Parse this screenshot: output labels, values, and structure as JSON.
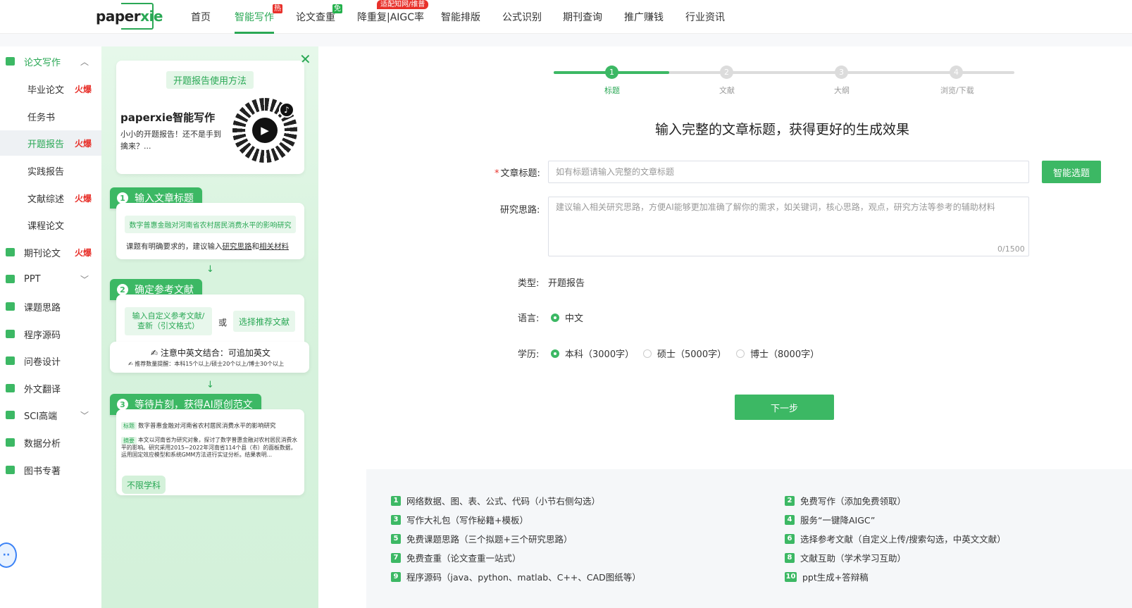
{
  "nav": {
    "logo": "paperxie",
    "items": [
      {
        "label": "首页"
      },
      {
        "label": "智能写作",
        "badge": "热"
      },
      {
        "label": "论文查重",
        "badge": "免"
      },
      {
        "label": "降重复|AIGC率",
        "badge": "适配知网/维普"
      },
      {
        "label": "智能排版"
      },
      {
        "label": "公式识别"
      },
      {
        "label": "期刊查询"
      },
      {
        "label": "推广赚钱"
      },
      {
        "label": "行业资讯"
      }
    ],
    "active": "智能写作"
  },
  "sidebar": {
    "hot_label": "火爆",
    "items": [
      {
        "label": "论文写作",
        "icon": "pen-icon",
        "expanded": true
      },
      {
        "label": "毕业论文",
        "hot": true
      },
      {
        "label": "任务书"
      },
      {
        "label": "开题报告",
        "hot": true,
        "active": true
      },
      {
        "label": "实践报告"
      },
      {
        "label": "文献综述",
        "hot": true
      },
      {
        "label": "课程论文"
      },
      {
        "label": "期刊论文",
        "icon": "journal-icon",
        "hot": true
      },
      {
        "label": "PPT",
        "icon": "ppt-icon",
        "expandable": true
      },
      {
        "label": "课题思路",
        "icon": "idea-icon"
      },
      {
        "label": "程序源码",
        "icon": "code-icon"
      },
      {
        "label": "问卷设计",
        "icon": "survey-icon"
      },
      {
        "label": "外文翻译",
        "icon": "translate-icon"
      },
      {
        "label": "SCI高端",
        "icon": "sci-icon",
        "expandable": true
      },
      {
        "label": "数据分析",
        "icon": "chart-icon"
      },
      {
        "label": "图书专著",
        "icon": "book-icon"
      }
    ]
  },
  "guide": {
    "howto": "开题报告使用方法",
    "brand": "paperxie智能写作",
    "desc": "小小的开题报告！还不是手到擒来？...",
    "step1": {
      "num": "1",
      "label": "输入文章标题",
      "example": "数字普惠金融对河南省农村居民消费水平的影响研究",
      "tip_prefix": "课题有明确要求的，建议输入",
      "tip_link1": "研究思路",
      "tip_and": "和",
      "tip_link2": "相关材料"
    },
    "step2": {
      "num": "2",
      "label": "确定参考文献",
      "custom": "输入自定义参考文献/查新（引文格式）",
      "or": "或",
      "recommend": "选择推荐文献"
    },
    "note": {
      "main": "注意中英文结合：可追加英文",
      "sub": "推荐数量提醒：本科15个以上/硕士20个以上/博士30个以上"
    },
    "step3": {
      "num": "3",
      "label": "等待片刻，获得AI原创范文",
      "tag_title": "标题",
      "title": "数字普惠金融对河南省农村居民消费水平的影响研究",
      "tag_abstract": "摘要",
      "abstract": "本文以河南省为研究对象，探讨了数字普惠金融对农村居民消费水平的影响。研究采用2015~2022年河南省114个县（市）的面板数据，运用固定效应模型和系统GMM方法进行实证分析。结果表明...",
      "any_subject": "不限学科"
    }
  },
  "steps": [
    {
      "num": "1",
      "label": "标题",
      "active": true
    },
    {
      "num": "2",
      "label": "文献"
    },
    {
      "num": "3",
      "label": "大纲"
    },
    {
      "num": "4",
      "label": "浏览/下载"
    }
  ],
  "progress_fraction": 0.25,
  "form": {
    "headline": "输入完整的文章标题，获得更好的生成效果",
    "title_label": "文章标题:",
    "title_placeholder": "如有标题请输入完整的文章标题",
    "smart_button": "智能选题",
    "idea_label": "研究思路:",
    "idea_placeholder": "建议输入相关研究思路，方便AI能够更加准确了解你的需求，如关键词，核心思路，观点，研究方法等参考的辅助材料",
    "counter": "0/1500",
    "type_label": "类型:",
    "type_value": "开题报告",
    "lang_label": "语言:",
    "lang_option": "中文",
    "degree_label": "学历:",
    "degree_options": [
      "本科（3000字）",
      "硕士（5000字）",
      "博士（8000字）"
    ],
    "degree_selected": 0,
    "next_button": "下一步"
  },
  "features": [
    {
      "num": "1",
      "text": "网络数据、图、表、公式、代码（小节右侧勾选）"
    },
    {
      "num": "2",
      "text": "免费写作（添加免费领取）"
    },
    {
      "num": "3",
      "text": "写作大礼包（写作秘籍+模板）"
    },
    {
      "num": "4",
      "text": "服务“一键降AIGC”"
    },
    {
      "num": "5",
      "text": "免费课题思路（三个拟题+三个研究思路）"
    },
    {
      "num": "6",
      "text": "选择参考文献（自定义上传/搜索勾选，中英文文献）"
    },
    {
      "num": "7",
      "text": "免费查重（论文查重一站式）"
    },
    {
      "num": "8",
      "text": "文献互助（学术学习互助）"
    },
    {
      "num": "9",
      "text": "程序源码（java、python、matlab、C++、CAD图纸等）"
    },
    {
      "num": "10",
      "text": "ppt生成+答辩稿"
    }
  ],
  "colors": {
    "accent": "#3cb864",
    "hot": "#e8312b"
  }
}
